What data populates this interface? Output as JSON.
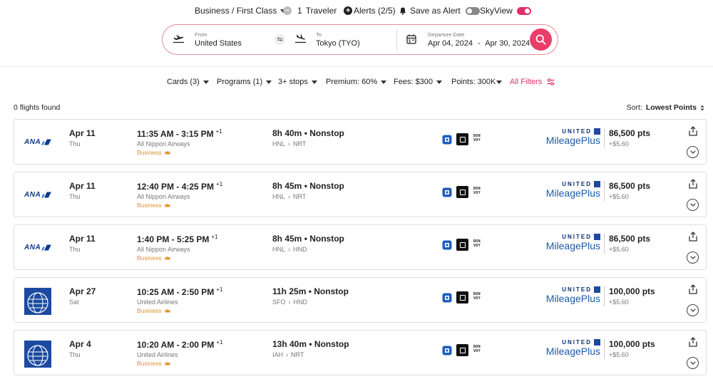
{
  "topbar": {
    "cabin": "Business / First Class",
    "traveler_count": "1",
    "traveler_label": "Traveler",
    "alerts": "Alerts (2/5)",
    "save_alert": "Save as Alert",
    "skyview": "SkyView",
    "save_alert_on": false,
    "skyview_on": true
  },
  "search": {
    "from_label": "From",
    "from_value": "United States",
    "to_label": "To",
    "to_value": "Tokyo (TYO)",
    "date_label": "Departure Date",
    "date_start": "Apr 04, 2024",
    "date_sep": "-",
    "date_end": "Apr 30, 2024"
  },
  "filters": {
    "cards": "Cards (3)",
    "programs": "Programs (1)",
    "stops": "3+ stops",
    "premium": "Premium: 60%",
    "fees": "Fees: $300",
    "points": "Points: 300K",
    "all": "All Filters"
  },
  "results": {
    "found": "0 flights found",
    "sort_label": "Sort:",
    "sort_value": "Lowest Points"
  },
  "flights": [
    {
      "airline_logo": "ana-logo",
      "date": "Apr 11",
      "dow": "Thu",
      "time": "11:35 AM - 3:15 PM",
      "plus": "+1",
      "airline": "All Nippon Airways",
      "cabin": "Business",
      "duration": "8h 40m • Nonstop",
      "from": "HNL",
      "to": "NRT",
      "program_top": "UNITED",
      "program_name": "MileagePlus",
      "points": "86,500 pts",
      "fee": "+$5.60"
    },
    {
      "airline_logo": "ana-logo",
      "date": "Apr 11",
      "dow": "Thu",
      "time": "12:40 PM - 4:25 PM",
      "plus": "+1",
      "airline": "All Nippon Airways",
      "cabin": "Business",
      "duration": "8h 45m • Nonstop",
      "from": "HNL",
      "to": "NRT",
      "program_top": "UNITED",
      "program_name": "MileagePlus",
      "points": "86,500 pts",
      "fee": "+$5.60"
    },
    {
      "airline_logo": "ana-logo",
      "date": "Apr 11",
      "dow": "Thu",
      "time": "1:40 PM - 5:25 PM",
      "plus": "+1",
      "airline": "All Nippon Airways",
      "cabin": "Business",
      "duration": "8h 45m • Nonstop",
      "from": "HNL",
      "to": "HND",
      "program_top": "UNITED",
      "program_name": "MileagePlus",
      "points": "86,500 pts",
      "fee": "+$5.60"
    },
    {
      "airline_logo": "united-logo",
      "date": "Apr 27",
      "dow": "Sat",
      "time": "10:25 AM - 2:50 PM",
      "plus": "+1",
      "airline": "United Airlines",
      "cabin": "Business",
      "duration": "11h 25m • Nonstop",
      "from": "SFO",
      "to": "HND",
      "program_top": "UNITED",
      "program_name": "MileagePlus",
      "points": "100,000 pts",
      "fee": "+$5.60"
    },
    {
      "airline_logo": "united-logo",
      "date": "Apr 4",
      "dow": "Thu",
      "time": "10:20 AM - 2:00 PM",
      "plus": "+1",
      "airline": "United Airlines",
      "cabin": "Business",
      "duration": "13h 40m • Nonstop",
      "from": "IAH",
      "to": "NRT",
      "program_top": "UNITED",
      "program_name": "MileagePlus",
      "points": "100,000 pts",
      "fee": "+$5.60"
    }
  ],
  "ana_logo_text": "ANA",
  "bonvoy_text": "BON VOY",
  "colors": {
    "accent": "#e0306a",
    "search_btn": "#ea3e6a",
    "cabin": "#e0902a",
    "united_blue": "#1e5aa8"
  }
}
